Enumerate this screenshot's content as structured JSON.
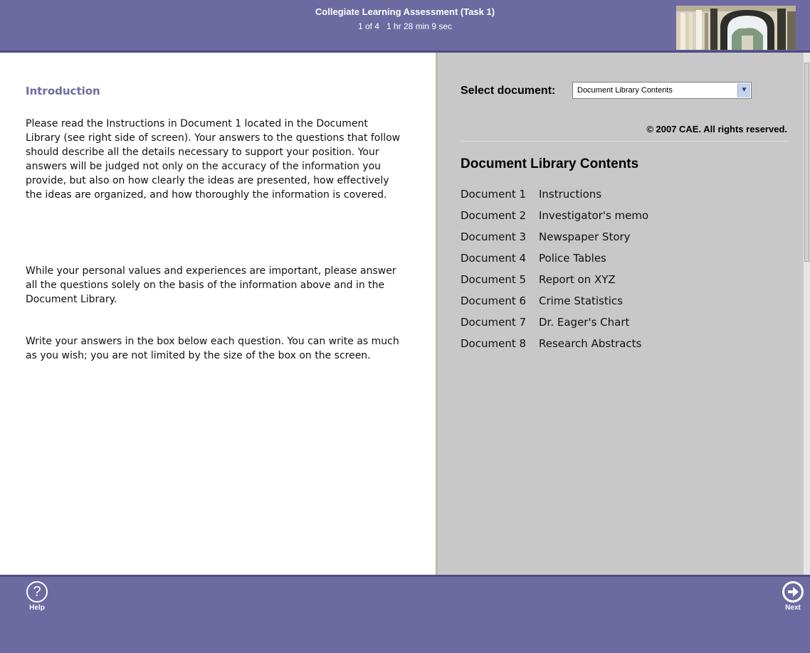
{
  "header": {
    "title": "Collegiate Learning Assessment  (Task 1)",
    "progress": "1 of 4",
    "timer": "1 hr 28 min 9 sec"
  },
  "intro": {
    "heading": "Introduction",
    "paragraphs": [
      "Please read the Instructions in Document 1 located in the Document Library (see right side of screen). Your answers to the questions that follow should describe all the details necessary to support your position. Your answers will be judged not only on the accuracy of the information you provide, but also on how clearly the ideas are presented, how effectively the ideas are organized, and how thoroughly the information is covered.",
      "While your personal values and experiences are important, please answer all the questions solely on the basis of the information above and in the Document Library.",
      "Write your answers in the box below each question. You can write as much as you wish; you are not limited by the size of the box on the screen."
    ]
  },
  "library": {
    "select_label": "Select document:",
    "select_value": "Document Library Contents",
    "copyright": "© 2007 CAE. All rights reserved.",
    "heading": "Document Library Contents",
    "documents": [
      {
        "number": "Document 1",
        "title": "Instructions"
      },
      {
        "number": "Document 2",
        "title": "Investigator's memo"
      },
      {
        "number": "Document 3",
        "title": "Newspaper Story"
      },
      {
        "number": "Document 4",
        "title": "Police Tables"
      },
      {
        "number": "Document 5",
        "title": "Report on XYZ"
      },
      {
        "number": "Document 6",
        "title": "Crime Statistics"
      },
      {
        "number": "Document 7",
        "title": "Dr. Eager's Chart"
      },
      {
        "number": "Document 8",
        "title": "Research Abstracts"
      }
    ]
  },
  "footer": {
    "help_label": "Help",
    "next_label": "Next"
  },
  "colors": {
    "bar": "#6d6aa2",
    "accent_text": "#6d6aa2",
    "right_pane": "#c8c8c8"
  },
  "icons": {
    "header": "campus-arches-image",
    "help": "question-circle-icon",
    "next": "arrow-right-circle-icon",
    "dropdown": "chevron-down-icon"
  }
}
